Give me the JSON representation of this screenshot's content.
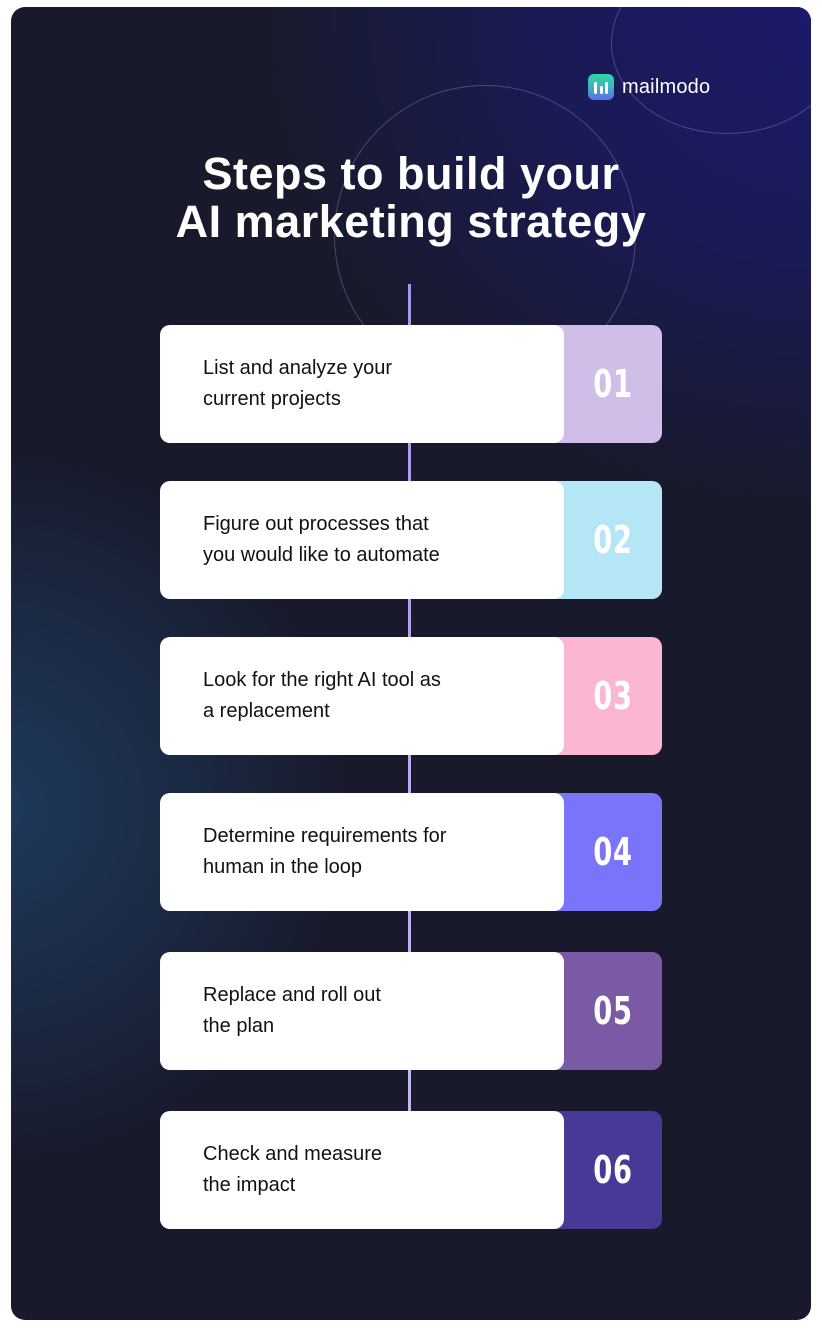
{
  "brand": {
    "name": "mailmodo",
    "logo_icon": "mailmodo-logo-icon"
  },
  "title": {
    "line1": "Steps to build your",
    "line2": "AI marketing strategy"
  },
  "steps": [
    {
      "number": "01",
      "line1": "List and analyze your",
      "line2": "current projects",
      "color": "#d0bde8"
    },
    {
      "number": "02",
      "line1": "Figure out processes that",
      "line2": "you would like to automate",
      "color": "#b4e6f6"
    },
    {
      "number": "03",
      "line1": "Look for the right AI tool as",
      "line2": "a replacement",
      "color": "#fbb6d2"
    },
    {
      "number": "04",
      "line1": "Determine requirements for",
      "line2": "human in the loop",
      "color": "#7a74fa"
    },
    {
      "number": "05",
      "line1": "Replace and roll out",
      "line2": "the plan",
      "color": "#7a5aa4"
    },
    {
      "number": "06",
      "line1": "Check and measure",
      "line2": "the impact",
      "color": "#463a96"
    }
  ]
}
